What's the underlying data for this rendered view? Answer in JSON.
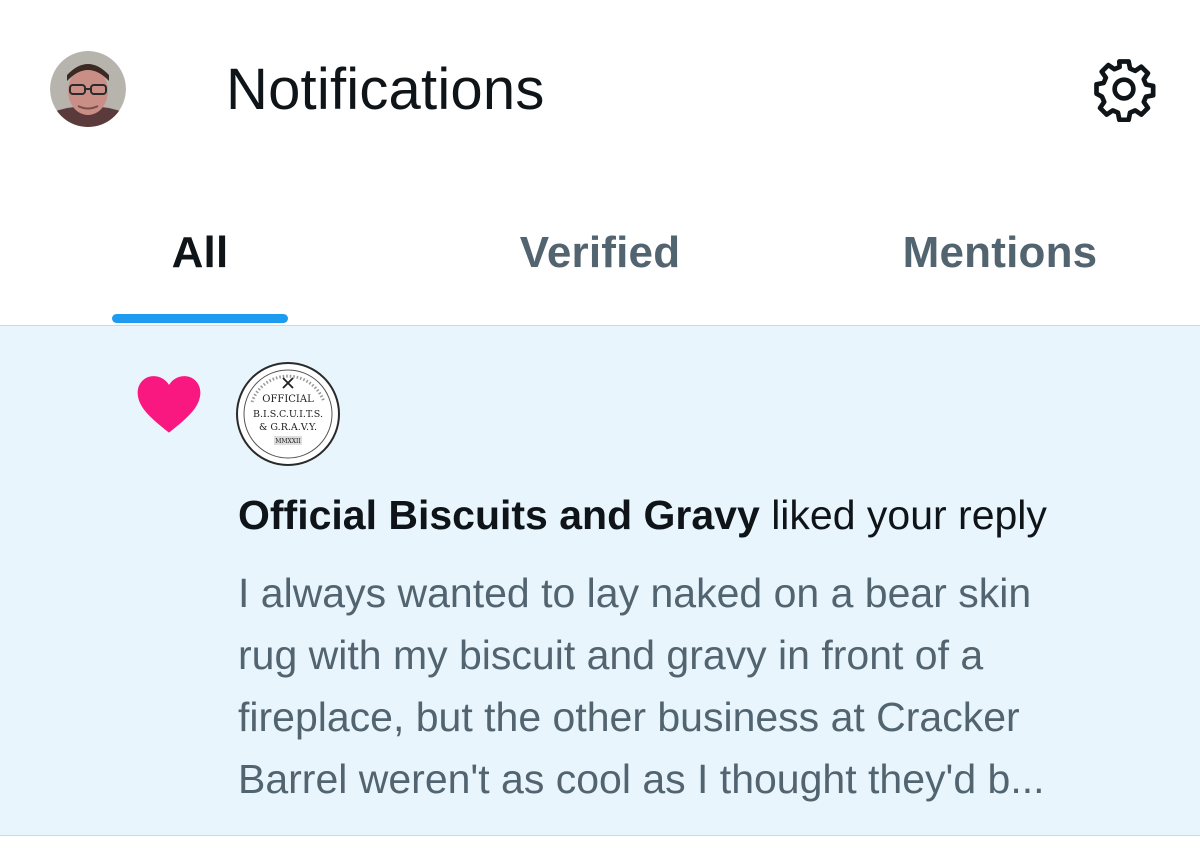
{
  "header": {
    "title": "Notifications",
    "avatar_icon": "user-avatar",
    "settings_icon": "gear-icon"
  },
  "tabs": [
    {
      "label": "All",
      "active": true
    },
    {
      "label": "Verified",
      "active": false
    },
    {
      "label": "Mentions",
      "active": false
    }
  ],
  "notification": {
    "icon": "heart-icon",
    "actor_name": "Official Biscuits and Gravy",
    "action": " liked your reply",
    "avatar_logo": {
      "line1": "OFFICIAL",
      "line2": "B.I.S.C.U.I.T.S.",
      "line3": "& G.R.A.V.Y.",
      "line4": "MMXXII"
    },
    "reply_lines": [
      "I always wanted to lay naked on a bear skin",
      "rug with my biscuit and gravy in front of a",
      "fireplace, but the other business at Cracker",
      "Barrel weren't as cool as I thought they'd b..."
    ]
  },
  "colors": {
    "accent": "#1d9bf0",
    "like": "#f91880",
    "notification_bg": "#e8f5fd",
    "secondary_text": "#536471",
    "primary_text": "#0f1419"
  }
}
